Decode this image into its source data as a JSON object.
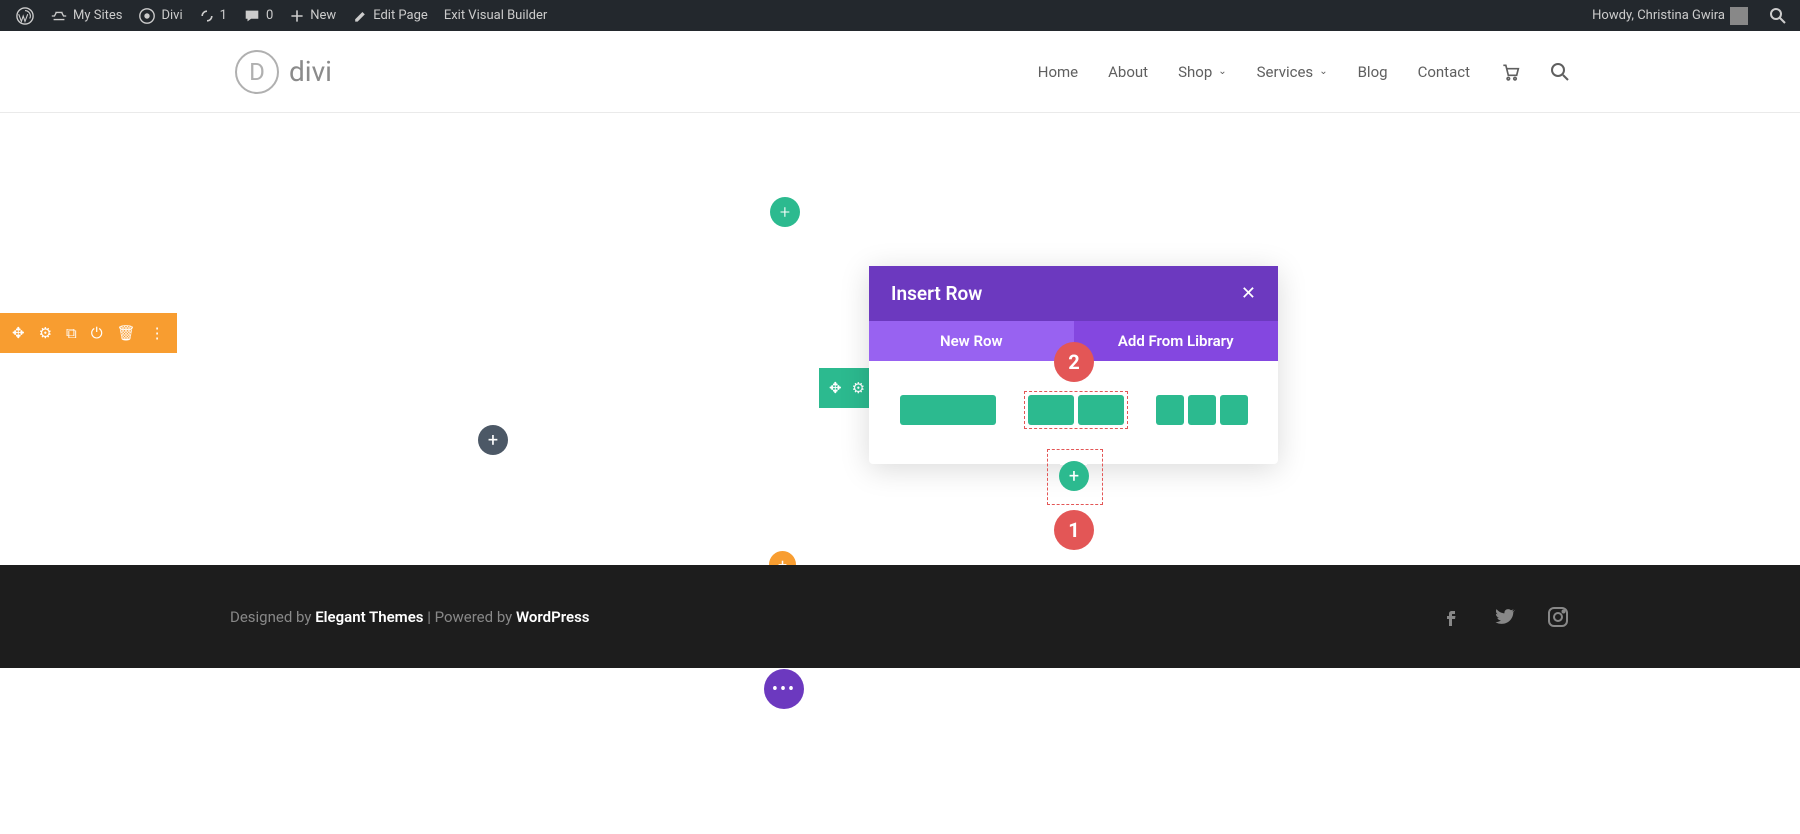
{
  "admin_bar": {
    "my_sites": "My Sites",
    "site_name": "Divi",
    "updates": "1",
    "comments": "0",
    "new": "New",
    "edit_page": "Edit Page",
    "exit_builder": "Exit Visual Builder",
    "greeting": "Howdy, Christina Gwira"
  },
  "header": {
    "logo_text": "divi",
    "logo_letter": "D",
    "nav": {
      "home": "Home",
      "about": "About",
      "shop": "Shop",
      "services": "Services",
      "blog": "Blog",
      "contact": "Contact"
    }
  },
  "popup": {
    "title": "Insert Row",
    "tab_new": "New Row",
    "tab_library": "Add From Library"
  },
  "annotations": {
    "one": "1",
    "two": "2"
  },
  "footer": {
    "designed_by": "Designed by ",
    "elegant": "Elegant Themes",
    "separator": " | Powered by ",
    "wordpress": "WordPress"
  }
}
